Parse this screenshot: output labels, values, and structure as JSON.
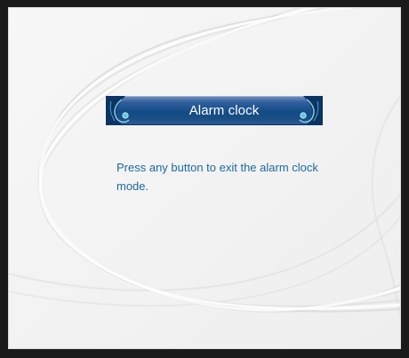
{
  "dialog": {
    "title": "Alarm clock",
    "message": "Press any button to exit the alarm clock mode."
  },
  "colors": {
    "frame": "#1a1a1a",
    "background": "#f3f3f3",
    "banner": "#1a4e84",
    "title_text": "#ffffff",
    "message_text": "#1b6aa0"
  },
  "icons": {
    "banner_left": "ornament-swirl-icon",
    "banner_right": "ornament-swirl-icon"
  }
}
